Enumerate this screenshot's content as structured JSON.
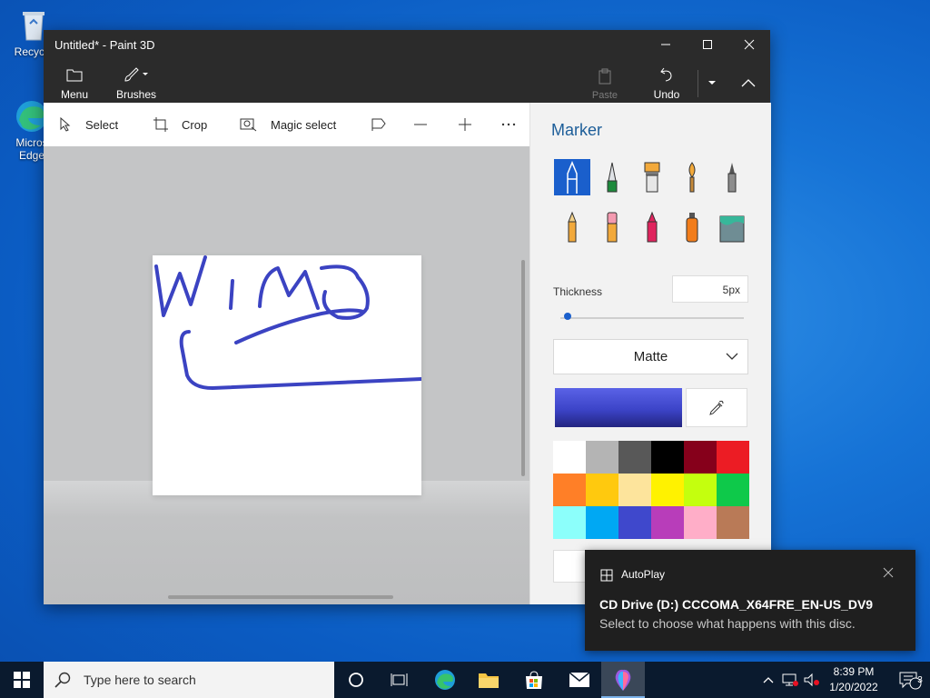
{
  "desktop": {
    "icons": [
      {
        "label": "Recycle"
      },
      {
        "label": "Microsoft\nEdge",
        "line1": "Micros",
        "line2": "Edge"
      }
    ]
  },
  "window": {
    "title": "Untitled* - Paint 3D",
    "ribbon": {
      "menu_label": "Menu",
      "brushes_label": "Brushes",
      "paste_label": "Paste",
      "undo_label": "Undo"
    },
    "toolbar": {
      "select_label": "Select",
      "crop_label": "Crop",
      "magic_select_label": "Magic select"
    },
    "panel": {
      "title": "Marker",
      "thickness_label": "Thickness",
      "thickness_value": "5px",
      "thickness_level": 0.02,
      "finish_selected": "Matte",
      "current_color": "#3c44c8",
      "palette": [
        "#ffffff",
        "#b4b4b4",
        "#585858",
        "#000000",
        "#86001b",
        "#ec1c24",
        "#ff7f27",
        "#ffc90e",
        "#fde49c",
        "#fff200",
        "#c4ff0e",
        "#0ec94a",
        "#8cfffb",
        "#00a8f3",
        "#3f48cc",
        "#b83dba",
        "#ffaec8",
        "#b97a57"
      ],
      "brushes": [
        "marker-icon",
        "calligraphy-pen-icon",
        "oil-brush-icon",
        "watercolor-icon",
        "pixel-pen-icon",
        "pencil-icon",
        "eraser-icon",
        "crayon-icon",
        "spray-can-icon",
        "fill-bucket-icon"
      ]
    }
  },
  "toast": {
    "app_name": "AutoPlay",
    "heading": "CD Drive (D:) CCCOMA_X64FRE_EN-US_DV9",
    "body": "Select to choose what happens with this disc."
  },
  "taskbar": {
    "search_placeholder": "Type here to search",
    "time": "8:39 PM",
    "date": "1/20/2022",
    "notification_count": "3"
  }
}
